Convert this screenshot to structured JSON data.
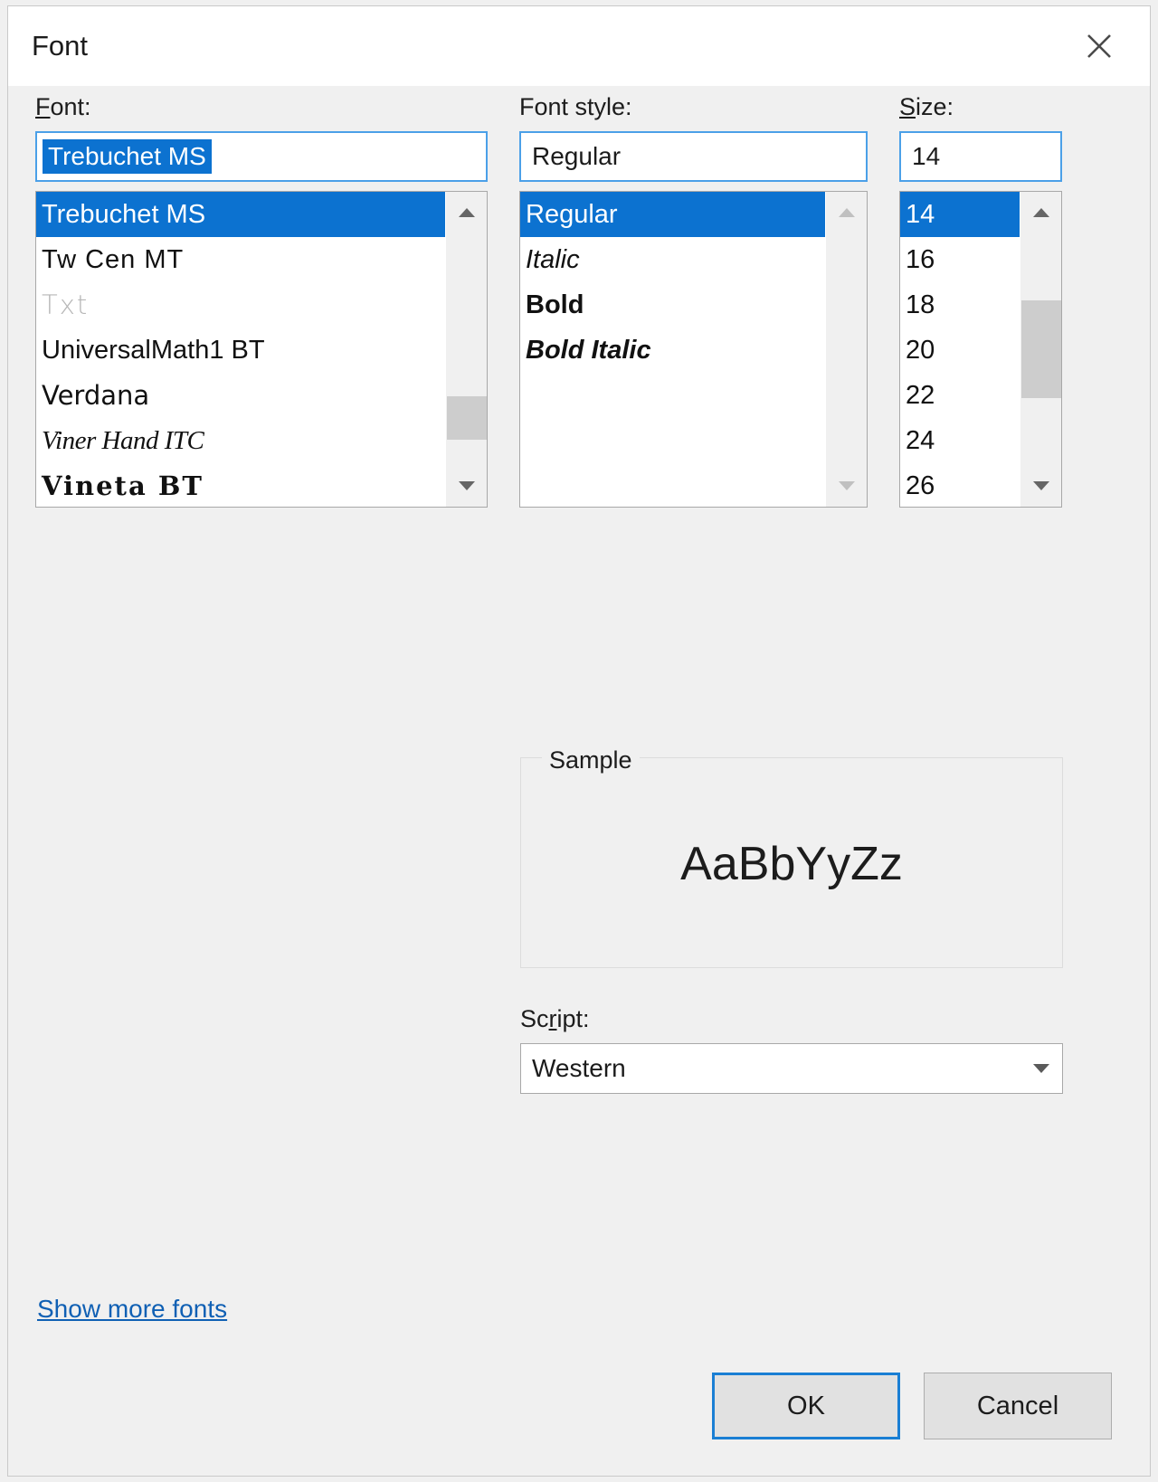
{
  "window": {
    "title": "Font",
    "close_icon": "close-icon"
  },
  "font_column": {
    "label": "Font:",
    "label_accel": "F",
    "label_rest": "ont:",
    "input_value": "Trebuchet MS",
    "items": [
      {
        "name": "Trebuchet MS",
        "selected": true,
        "style_class": "fp-sans",
        "greyed": false
      },
      {
        "name": "Tw Cen MT",
        "selected": false,
        "style_class": "fp-sansc",
        "greyed": false
      },
      {
        "name": "Txt",
        "selected": false,
        "style_class": "fp-thin",
        "greyed": true
      },
      {
        "name": "UniversalMath1 BT",
        "selected": false,
        "style_class": "fp-sans",
        "greyed": false
      },
      {
        "name": "Verdana",
        "selected": false,
        "style_class": "fp-dejavu",
        "greyed": false
      },
      {
        "name": "Viner Hand ITC",
        "selected": false,
        "style_class": "fp-script",
        "greyed": false
      },
      {
        "name": "Vineta BT",
        "selected": false,
        "style_class": "fp-slab",
        "greyed": false
      }
    ]
  },
  "style_column": {
    "label": "Font style:",
    "input_value": "Regular",
    "items": [
      {
        "name": "Regular",
        "selected": true,
        "style_class": "st-reg"
      },
      {
        "name": "Italic",
        "selected": false,
        "style_class": "st-ital"
      },
      {
        "name": "Bold",
        "selected": false,
        "style_class": "st-bold"
      },
      {
        "name": "Bold Italic",
        "selected": false,
        "style_class": "st-bi"
      }
    ]
  },
  "size_column": {
    "label": "Size:",
    "label_accel": "S",
    "label_rest": "ize:",
    "input_value": "14",
    "items": [
      {
        "name": "14",
        "selected": true
      },
      {
        "name": "16",
        "selected": false
      },
      {
        "name": "18",
        "selected": false
      },
      {
        "name": "20",
        "selected": false
      },
      {
        "name": "22",
        "selected": false
      },
      {
        "name": "24",
        "selected": false
      },
      {
        "name": "26",
        "selected": false
      }
    ]
  },
  "sample": {
    "legend": "Sample",
    "text": "AaBbYyZz"
  },
  "script": {
    "label_pre": "Sc",
    "label_accel": "r",
    "label_post": "ipt:",
    "value": "Western"
  },
  "footer": {
    "show_more_fonts": "Show more fonts",
    "ok_label": "OK",
    "cancel_label": "Cancel"
  },
  "colors": {
    "accent": "#0c72d0",
    "focus_border": "#4ba0e8",
    "link": "#1060b4",
    "dialog_bg": "#f0f0f0"
  }
}
